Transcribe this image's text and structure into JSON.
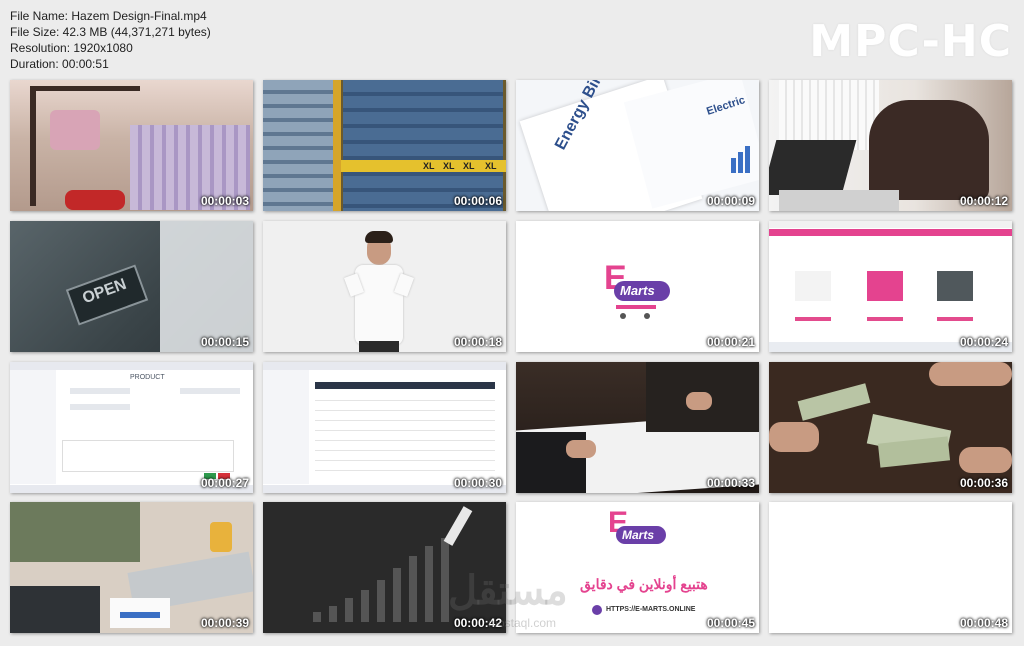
{
  "file_info": {
    "name": "File Name: Hazem Design-Final.mp4",
    "size": "File Size: 42.3 MB (44,371,271 bytes)",
    "resolution": "Resolution: 1920x1080",
    "duration": "Duration: 00:00:51"
  },
  "player_logo": "MPC-HC",
  "thumbnails": [
    {
      "time": "00:00:03",
      "scene": "clothing-store"
    },
    {
      "time": "00:00:06",
      "scene": "jeans-shelves",
      "shelf_labels": [
        "XL",
        "XL",
        "XL",
        "XL"
      ]
    },
    {
      "time": "00:00:09",
      "scene": "energy-bill",
      "texts": [
        "Energy Bill",
        "Electric"
      ]
    },
    {
      "time": "00:00:12",
      "scene": "stressed-man-laptop"
    },
    {
      "time": "00:00:15",
      "scene": "open-sign",
      "texts": [
        "OPEN"
      ]
    },
    {
      "time": "00:00:18",
      "scene": "man-pointing"
    },
    {
      "time": "00:00:21",
      "scene": "emarts-logo",
      "texts": [
        "E",
        "Marts"
      ]
    },
    {
      "time": "00:00:24",
      "scene": "store-website"
    },
    {
      "time": "00:00:27",
      "scene": "dashboard-product-form",
      "texts": [
        "PRODUCT"
      ]
    },
    {
      "time": "00:00:30",
      "scene": "dashboard-table"
    },
    {
      "time": "00:00:33",
      "scene": "business-handshake"
    },
    {
      "time": "00:00:36",
      "scene": "money-exchange"
    },
    {
      "time": "00:00:39",
      "scene": "accounting-desk"
    },
    {
      "time": "00:00:42",
      "scene": "growth-chart"
    },
    {
      "time": "00:00:45",
      "scene": "emarts-promo",
      "texts": [
        "E",
        "Marts",
        "هتبيع أونلاين في دقايق",
        "HTTPS://E-MARTS.ONLINE"
      ]
    },
    {
      "time": "00:00:48",
      "scene": "blank"
    }
  ],
  "watermark": {
    "arabic": "مستقل",
    "latin": "mostaql.com"
  }
}
